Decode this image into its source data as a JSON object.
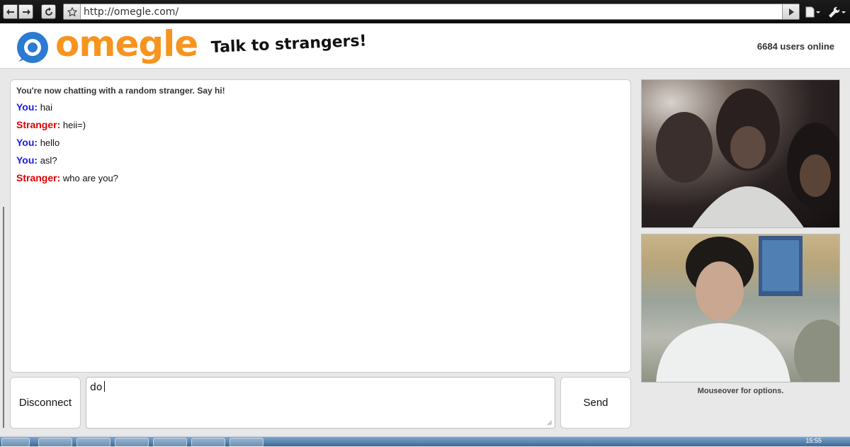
{
  "browser": {
    "url": "http://omegle.com/"
  },
  "header": {
    "logo_text": "omegle",
    "tagline": "Talk to strangers!",
    "users_online": "6684 users online"
  },
  "chat": {
    "status": "You're now chatting with a random stranger. Say hi!",
    "messages": [
      {
        "speaker": "You:",
        "text": "hai"
      },
      {
        "speaker": "Stranger:",
        "text": "heii=)"
      },
      {
        "speaker": "You:",
        "text": "hello"
      },
      {
        "speaker": "You:",
        "text": "asl?"
      },
      {
        "speaker": "Stranger:",
        "text": "who are you?"
      }
    ]
  },
  "controls": {
    "disconnect_label": "Disconnect",
    "input_value": "do",
    "send_label": "Send"
  },
  "video": {
    "note": "Mouseover for options."
  },
  "taskbar": {
    "clock": "15:55"
  },
  "colors": {
    "brand_orange": "#f7941d",
    "brand_blue": "#2b7bd0",
    "you_color": "#1a1ae6",
    "stranger_color": "#e00000"
  },
  "icons": [
    "back-icon",
    "forward-icon",
    "reload-icon",
    "star-icon",
    "go-icon",
    "page-icon",
    "wrench-icon"
  ]
}
